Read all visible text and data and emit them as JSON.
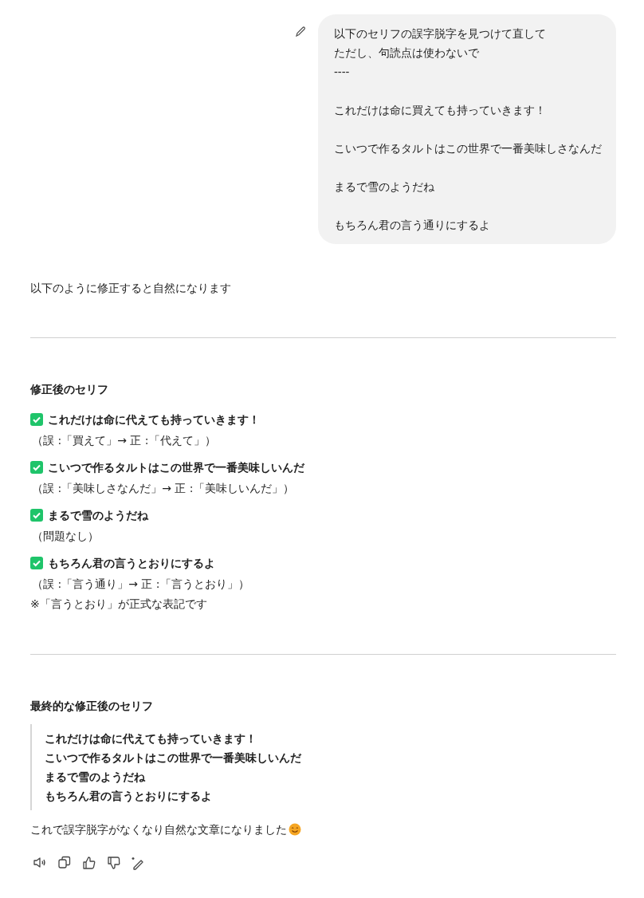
{
  "user_message": {
    "paragraphs": [
      [
        "以下のセリフの誤字脱字を見つけて直して",
        "ただし、句読点は使わないで",
        "----"
      ],
      [
        "これだけは命に買えても持っていきます！"
      ],
      [
        "こいつで作るタルトはこの世界で一番美味しさなんだ"
      ],
      [
        "まるで雪のようだね"
      ],
      [
        "もちろん君の言う通りにするよ"
      ]
    ]
  },
  "response": {
    "intro": "以下のように修正すると自然になります",
    "corrections": {
      "heading": "修正後のセリフ",
      "items": [
        {
          "line": "これだけは命に代えても持っていきます！",
          "note": "（誤 :「買えて」→ 正 :「代えて」）"
        },
        {
          "line": "こいつで作るタルトはこの世界で一番美味しいんだ",
          "note": "（誤 :「美味しさなんだ」→ 正 :「美味しいんだ」）"
        },
        {
          "line": "まるで雪のようだね",
          "note": "（問題なし）"
        },
        {
          "line": "もちろん君の言うとおりにするよ",
          "note": "（誤 :「言う通り」→ 正 :「言うとおり」）"
        }
      ],
      "footnote": "※「言うとおり」が正式な表記です"
    },
    "final": {
      "heading": "最終的な修正後のセリフ",
      "lines": [
        "これだけは命に代えても持っていきます！",
        "こいつで作るタルトはこの世界で一番美味しいんだ",
        "まるで雪のようだね",
        "もちろん君の言うとおりにするよ"
      ]
    },
    "closing": "これで誤字脱字がなくなり自然な文章になりました"
  }
}
